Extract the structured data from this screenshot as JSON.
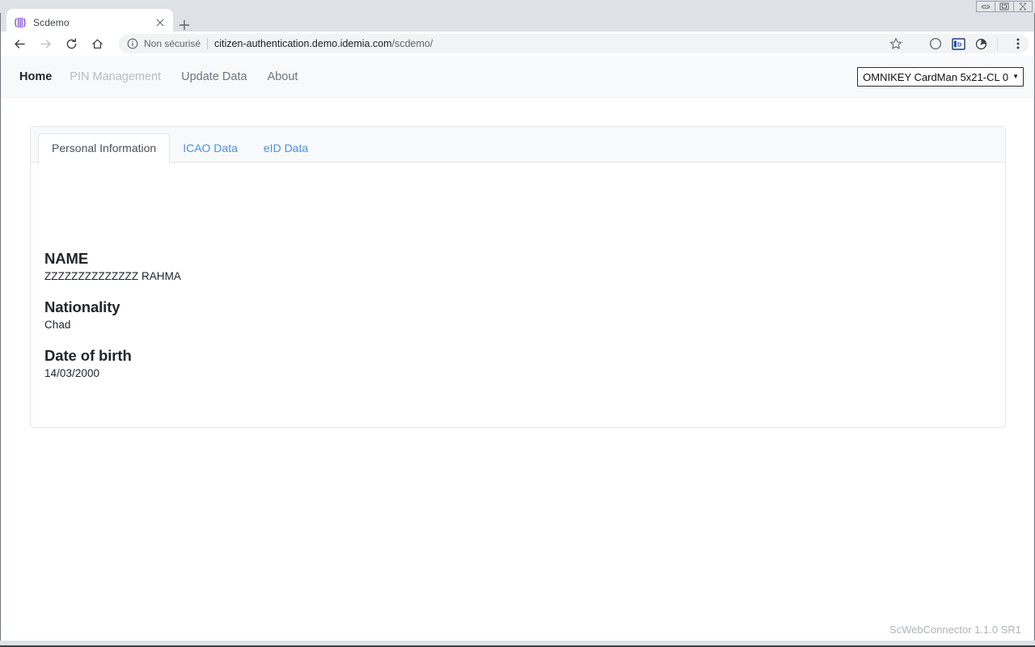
{
  "window": {
    "controls": {
      "minimize": "minimize",
      "maximize": "restore",
      "close": "close"
    }
  },
  "browser": {
    "tab": {
      "title": "Scdemo",
      "favicon": "signal-waves-icon",
      "close": "×"
    },
    "new_tab_label": "+",
    "nav": {
      "back": "back-arrow-icon",
      "forward": "forward-arrow-icon",
      "reload": "reload-icon",
      "home": "home-icon"
    },
    "omnibox": {
      "security_icon": "info-circle-icon",
      "security_label": "Non sécurisé",
      "url_domain": "citizen-authentication.demo.idemia.com",
      "url_path": "/scdemo/"
    },
    "actions": {
      "bookmark": "star-icon",
      "extension_1": "circle-moon-icon",
      "extension_2": "id-badge-icon",
      "extension_2_label": "iD",
      "extension_3": "swirl-icon",
      "menu": "three-dots-menu-icon"
    }
  },
  "app": {
    "nav_items": [
      {
        "label": "Home",
        "state": "active"
      },
      {
        "label": "PIN Management",
        "state": "disabled"
      },
      {
        "label": "Update Data",
        "state": "normal"
      },
      {
        "label": "About",
        "state": "normal"
      }
    ],
    "reader_select": {
      "value": "OMNIKEY CardMan 5x21-CL 0",
      "caret": "▼"
    },
    "card": {
      "tabs": [
        {
          "label": "Personal Information",
          "state": "active"
        },
        {
          "label": "ICAO Data",
          "state": "link"
        },
        {
          "label": "eID Data",
          "state": "link"
        }
      ],
      "fields": [
        {
          "label": "NAME",
          "value": "ZZZZZZZZZZZZZZ RAHMA"
        },
        {
          "label": "Nationality",
          "value": "Chad"
        },
        {
          "label": "Date of birth",
          "value": "14/03/2000"
        }
      ]
    },
    "footer_version": "ScWebConnector 1.1.0 SR1"
  }
}
